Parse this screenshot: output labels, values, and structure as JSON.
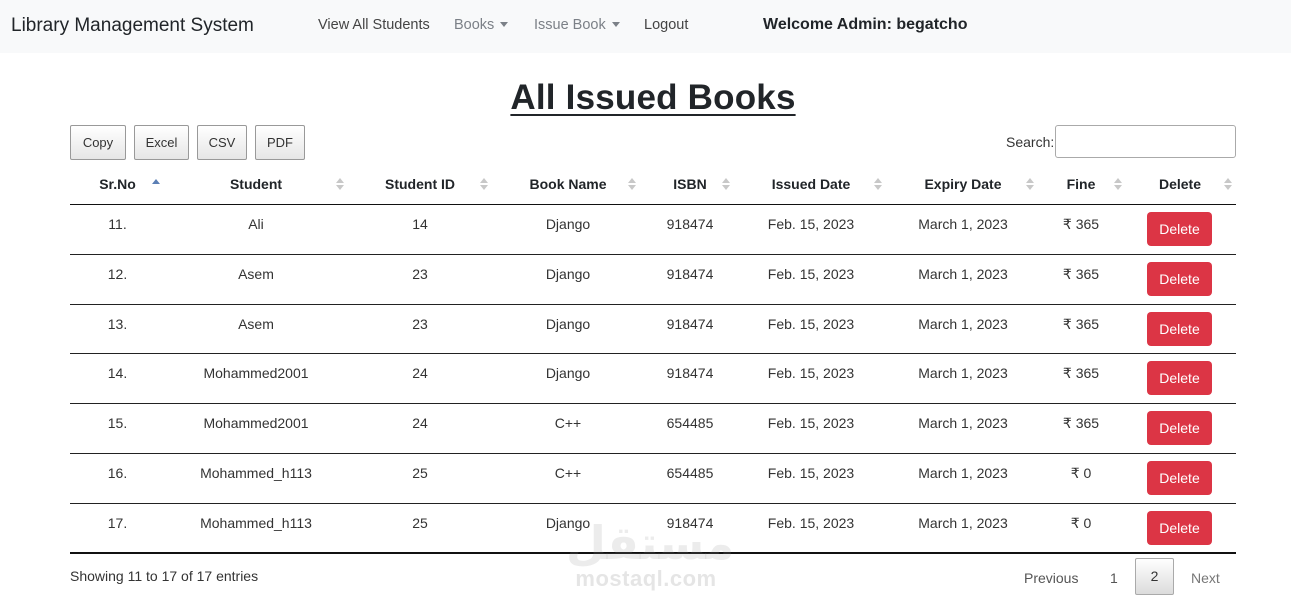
{
  "navbar": {
    "brand": "Library Management System",
    "items": [
      {
        "label": "View All Students"
      },
      {
        "label": "Books"
      },
      {
        "label": "Issue Book"
      },
      {
        "label": "Logout"
      }
    ],
    "welcome": "Welcome Admin: begatcho"
  },
  "page": {
    "title": "All Issued Books"
  },
  "export_buttons": [
    "Copy",
    "Excel",
    "CSV",
    "PDF"
  ],
  "search": {
    "label": "Search:",
    "value": ""
  },
  "table": {
    "columns": [
      "Sr.No",
      "Student",
      "Student ID",
      "Book Name",
      "ISBN",
      "Issued Date",
      "Expiry Date",
      "Fine",
      "Delete"
    ],
    "sorted_column": "Sr.No",
    "sort_direction": "ascending",
    "rows": [
      {
        "srno": "11.",
        "student": "Ali",
        "student_id": "14",
        "book": "Django",
        "isbn": "918474",
        "issued": "Feb. 15, 2023",
        "expiry": "March 1, 2023",
        "fine": "₹ 365",
        "action": "Delete"
      },
      {
        "srno": "12.",
        "student": "Asem",
        "student_id": "23",
        "book": "Django",
        "isbn": "918474",
        "issued": "Feb. 15, 2023",
        "expiry": "March 1, 2023",
        "fine": "₹ 365",
        "action": "Delete"
      },
      {
        "srno": "13.",
        "student": "Asem",
        "student_id": "23",
        "book": "Django",
        "isbn": "918474",
        "issued": "Feb. 15, 2023",
        "expiry": "March 1, 2023",
        "fine": "₹ 365",
        "action": "Delete"
      },
      {
        "srno": "14.",
        "student": "Mohammed2001",
        "student_id": "24",
        "book": "Django",
        "isbn": "918474",
        "issued": "Feb. 15, 2023",
        "expiry": "March 1, 2023",
        "fine": "₹ 365",
        "action": "Delete"
      },
      {
        "srno": "15.",
        "student": "Mohammed2001",
        "student_id": "24",
        "book": "C++",
        "isbn": "654485",
        "issued": "Feb. 15, 2023",
        "expiry": "March 1, 2023",
        "fine": "₹ 365",
        "action": "Delete"
      },
      {
        "srno": "16.",
        "student": "Mohammed_h113",
        "student_id": "25",
        "book": "C++",
        "isbn": "654485",
        "issued": "Feb. 15, 2023",
        "expiry": "March 1, 2023",
        "fine": "₹ 0",
        "action": "Delete"
      },
      {
        "srno": "17.",
        "student": "Mohammed_h113",
        "student_id": "25",
        "book": "Django",
        "isbn": "918474",
        "issued": "Feb. 15, 2023",
        "expiry": "March 1, 2023",
        "fine": "₹ 0",
        "action": "Delete"
      }
    ]
  },
  "footer": {
    "info": "Showing 11 to 17 of 17 entries",
    "pagination": {
      "previous": "Previous",
      "pages": [
        "1",
        "2"
      ],
      "current": "2",
      "next": "Next"
    }
  },
  "watermark": {
    "arabic": "مستقل",
    "latin": "mostaql.com"
  },
  "colors": {
    "navbar_bg": "#f8f9fa",
    "danger": "#dc3545",
    "sort_active": "#5b7fb5"
  }
}
